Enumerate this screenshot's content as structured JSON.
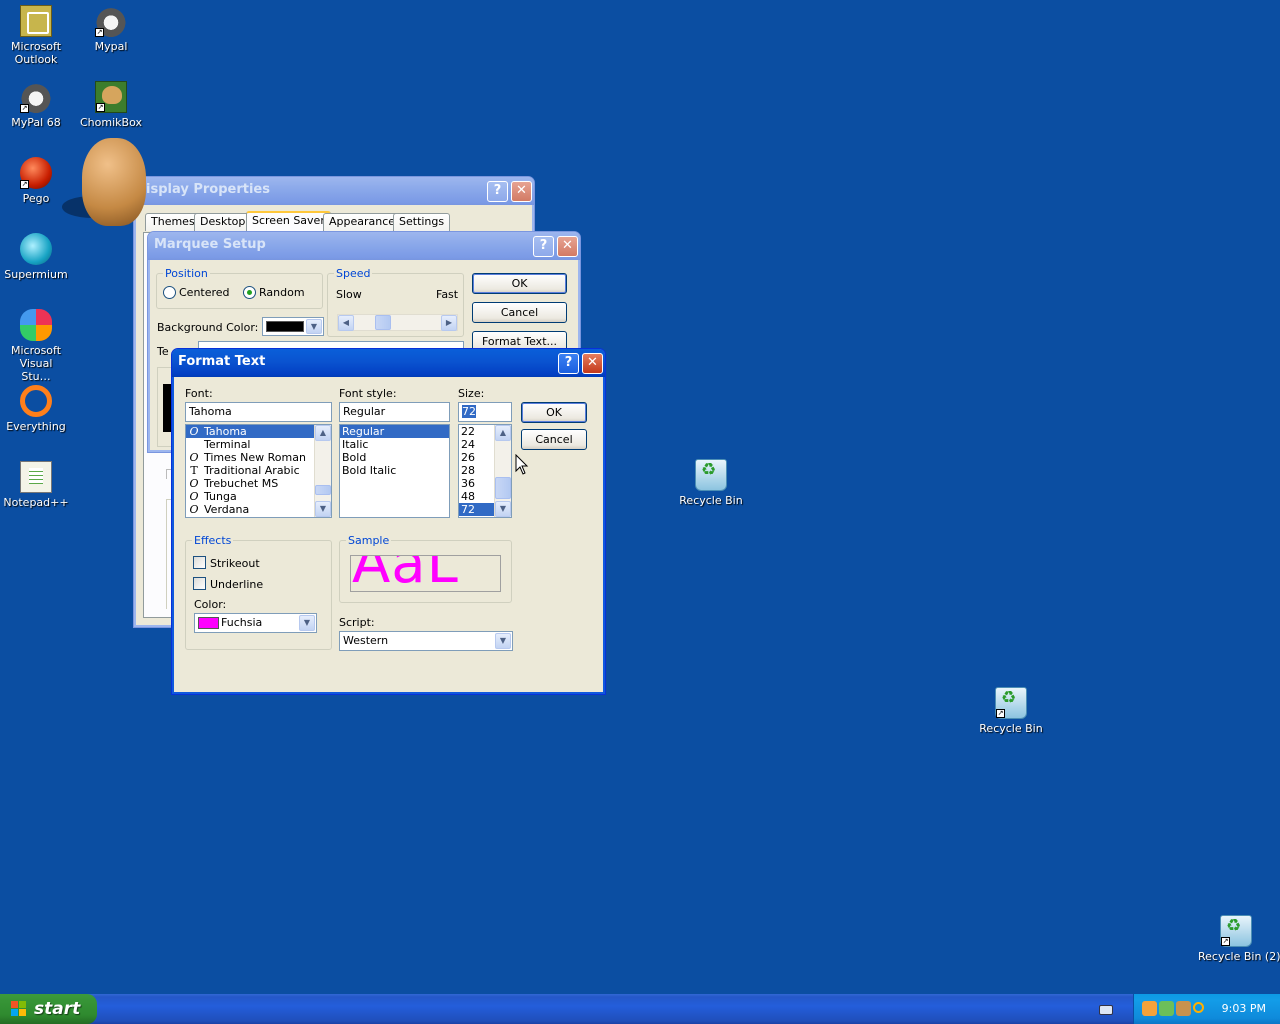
{
  "desktop": {
    "icons": [
      {
        "label": "Microsoft Outlook",
        "icon": "outlook-icon"
      },
      {
        "label": "Mypal",
        "icon": "mypal-icon"
      },
      {
        "label": "MyPal 68",
        "icon": "mypal68-icon"
      },
      {
        "label": "ChomikBox",
        "icon": "chomikbox-icon"
      },
      {
        "label": "Pego",
        "icon": "pego-icon"
      },
      {
        "label": "Supermium",
        "icon": "supermium-icon"
      },
      {
        "label": "Microsoft Visual Stu…",
        "icon": "visual-studio-icon"
      },
      {
        "label": "Everything",
        "icon": "everything-icon"
      },
      {
        "label": "Notepad++",
        "icon": "notepad-plus-plus-icon"
      },
      {
        "label": "Recycle Bin",
        "icon": "recycle-bin-icon"
      },
      {
        "label": "Recycle Bin",
        "icon": "recycle-bin-icon"
      },
      {
        "label": "Recycle Bin (2)",
        "icon": "recycle-bin-icon"
      }
    ]
  },
  "display_properties": {
    "title": "isplay Properties",
    "tabs": [
      "Themes",
      "Desktop",
      "Screen Saver",
      "Appearance",
      "Settings"
    ],
    "active_tab": "Screen Saver"
  },
  "marquee_setup": {
    "title": "Marquee Setup",
    "position": {
      "title": "Position",
      "options": [
        "Centered",
        "Random"
      ],
      "selected": "Random"
    },
    "speed": {
      "title": "Speed",
      "slow": "Slow",
      "fast": "Fast"
    },
    "background_color_label": "Background Color:",
    "background_color": "#000000",
    "text_label_partial": "Te",
    "buttons": {
      "ok": "OK",
      "cancel": "Cancel",
      "format_text": "Format Text..."
    }
  },
  "format_text": {
    "title": "Format Text",
    "font_label": "Font:",
    "font_value": "Tahoma",
    "fonts": [
      {
        "name": "Tahoma",
        "type": "opentype"
      },
      {
        "name": "Terminal",
        "type": "raster"
      },
      {
        "name": "Times New Roman",
        "type": "opentype"
      },
      {
        "name": "Traditional Arabic",
        "type": "truetype"
      },
      {
        "name": "Trebuchet MS",
        "type": "opentype"
      },
      {
        "name": "Tunga",
        "type": "opentype"
      },
      {
        "name": "Verdana",
        "type": "opentype"
      }
    ],
    "selected_font": "Tahoma",
    "style_label": "Font style:",
    "style_value": "Regular",
    "styles": [
      "Regular",
      "Italic",
      "Bold",
      "Bold Italic"
    ],
    "selected_style": "Regular",
    "size_label": "Size:",
    "size_value": "72",
    "sizes": [
      "22",
      "24",
      "26",
      "28",
      "36",
      "48",
      "72"
    ],
    "selected_size": "72",
    "buttons": {
      "ok": "OK",
      "cancel": "Cancel"
    },
    "effects": {
      "title": "Effects",
      "strikeout": "Strikeout",
      "underline": "Underline",
      "strikeout_checked": false,
      "underline_checked": false
    },
    "color_label": "Color:",
    "color_value": "Fuchsia",
    "color_swatch": "#ff00ff",
    "sample_title": "Sample",
    "sample_text": "AaL",
    "script_label": "Script:",
    "script_value": "Western"
  },
  "taskbar": {
    "start_label": "start",
    "clock": "9:03 PM"
  }
}
